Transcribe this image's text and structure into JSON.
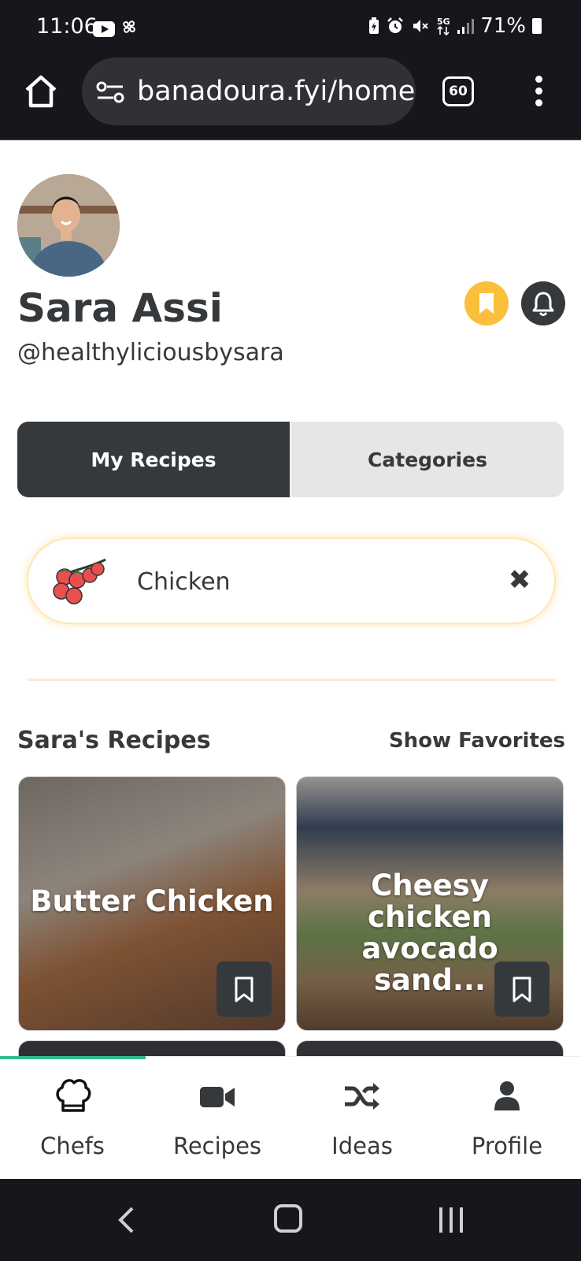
{
  "status_bar": {
    "time": "11:06",
    "battery": "71%",
    "left_icons": [
      "youtube-icon",
      "pinwheel-icon"
    ],
    "right_icons": [
      "battery-saver-icon",
      "alarm-icon",
      "mute-icon",
      "5g-icon",
      "signal-icon",
      "battery-icon"
    ]
  },
  "browser": {
    "url": "banadoura.fyi/home",
    "tab_count": "60"
  },
  "chef": {
    "name": "Sara Assi",
    "handle": "@healthyliciousbysara"
  },
  "tabs": [
    {
      "label": "My Recipes",
      "active": true
    },
    {
      "label": "Categories",
      "active": false
    }
  ],
  "filter": {
    "label": "Chicken",
    "icon": "tomato-vine-icon"
  },
  "section": {
    "title": "Sara's Recipes",
    "show_favorites": "Show Favorites"
  },
  "recipes": [
    {
      "title": "Butter Chicken"
    },
    {
      "title": "Cheesy chicken avocado sand..."
    }
  ],
  "bottom_nav": [
    {
      "label": "Chefs",
      "icon": "chef-hat-icon",
      "active": true
    },
    {
      "label": "Recipes",
      "icon": "video-camera-icon"
    },
    {
      "label": "Ideas",
      "icon": "shuffle-icon"
    },
    {
      "label": "Profile",
      "icon": "user-icon"
    }
  ],
  "colors": {
    "dark": "#36393c",
    "accent_yellow": "#fbbf3b",
    "accent_green": "#2ebc8f",
    "chip_glow": "#ffe7b5"
  }
}
